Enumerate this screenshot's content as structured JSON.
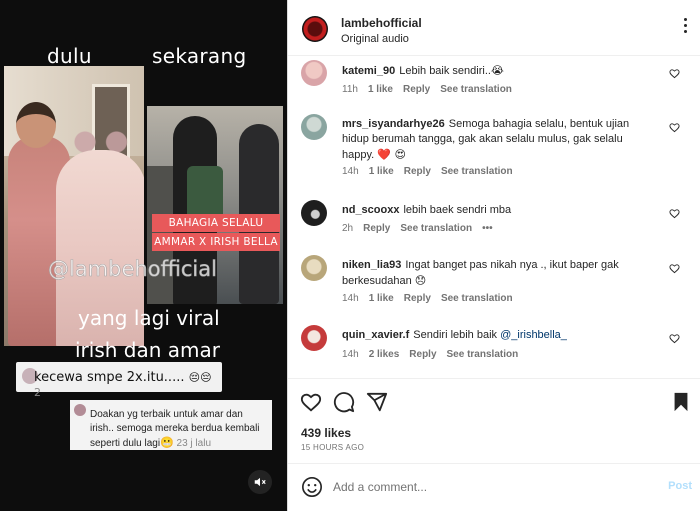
{
  "video": {
    "caption_left": "dulu",
    "caption_right": "sekarang",
    "tag_line1": "BAHAGIA SELALU",
    "tag_line2": "AMMAR X IRISH BELLA",
    "watermark": "@lambehofficial",
    "overlay_line1": "yang lagi viral",
    "overlay_line2": "irish dan amar",
    "bubble1_text": "kecewa smpe 2x.itu.....",
    "bubble1_suffix": "2",
    "bubble2_text": "Doakan yg terbaik untuk amar dan irish.. semoga mereka berdua kembali seperti dulu lagi",
    "bubble2_time": "23 j lalu",
    "mute_icon": "speaker-muted-icon"
  },
  "header": {
    "username": "lambehofficial",
    "audio": "Original audio"
  },
  "comments": [
    {
      "username": "katemi_90",
      "text": "Lebih baik sendiri..",
      "emoji": "😭",
      "time": "11h",
      "likes": "1 like",
      "reply": "Reply",
      "translate": "See translation",
      "avatar_color": "#d9a4a8"
    },
    {
      "username": "mrs_isyandarhye26",
      "text": "Semoga bahagia selalu, bentuk ujian hidup berumah tangga, gak akan selalu mulus, gak selalu happy.",
      "emoji": "❤️ 😍",
      "time": "14h",
      "likes": "1 like",
      "reply": "Reply",
      "translate": "See translation",
      "avatar_color": "#8aa5a0"
    },
    {
      "username": "nd_scooxx",
      "text": "lebih baek sendri mba",
      "emoji": "",
      "time": "2h",
      "likes": "",
      "reply": "Reply",
      "translate": "See translation",
      "more": "•••",
      "avatar_color": "#1e1e1e"
    },
    {
      "username": "niken_lia93",
      "text": "Ingat banget pas nikah nya ., ikut baper gak berkesudahan",
      "emoji": "😞",
      "time": "14h",
      "likes": "1 like",
      "reply": "Reply",
      "translate": "See translation",
      "avatar_color": "#b8a67a"
    },
    {
      "username": "quin_xavier.f",
      "text": "Sendiri lebih baik",
      "mention": "@_irishbella_",
      "emoji": "",
      "time": "14h",
      "likes": "2 likes",
      "reply": "Reply",
      "translate": "See translation",
      "avatar_color": "#c53b3b"
    }
  ],
  "actions": {
    "likes": "439 likes",
    "ago": "15 HOURS AGO"
  },
  "add_comment": {
    "placeholder": "Add a comment...",
    "post": "Post"
  },
  "colors": {
    "tag_bg": "#e8595a",
    "link": "#00376b",
    "post_disabled": "#b2dffc",
    "heart_red": "#ed4956"
  }
}
